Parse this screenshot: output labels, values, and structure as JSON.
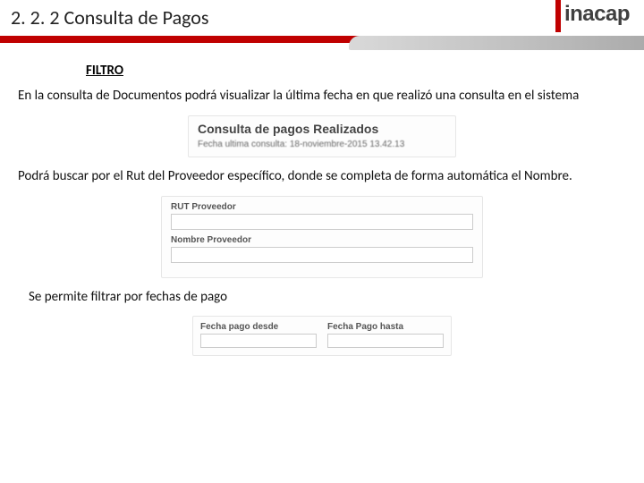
{
  "header": {
    "title": "2. 2. 2 Consulta de Pagos",
    "brand": "inacap"
  },
  "section": {
    "filtro_heading": "FILTRO",
    "para1": "En la consulta de Documentos podrá visualizar la última fecha en que realizó una consulta en el sistema",
    "para2": "Podrá buscar por el Rut del Proveedor específico, donde se completa de forma automática el Nombre.",
    "para3": "Se permite filtrar por fechas de pago"
  },
  "panel_consulta": {
    "title": "Consulta de pagos Realizados",
    "subtitle": "Fecha ultima consulta: 18-noviembre-2015 13.42.13"
  },
  "panel_form": {
    "rut_label": "RUT Proveedor",
    "nombre_label": "Nombre Proveedor"
  },
  "panel_dates": {
    "desde_label": "Fecha pago desde",
    "hasta_label": "Fecha Pago hasta"
  }
}
